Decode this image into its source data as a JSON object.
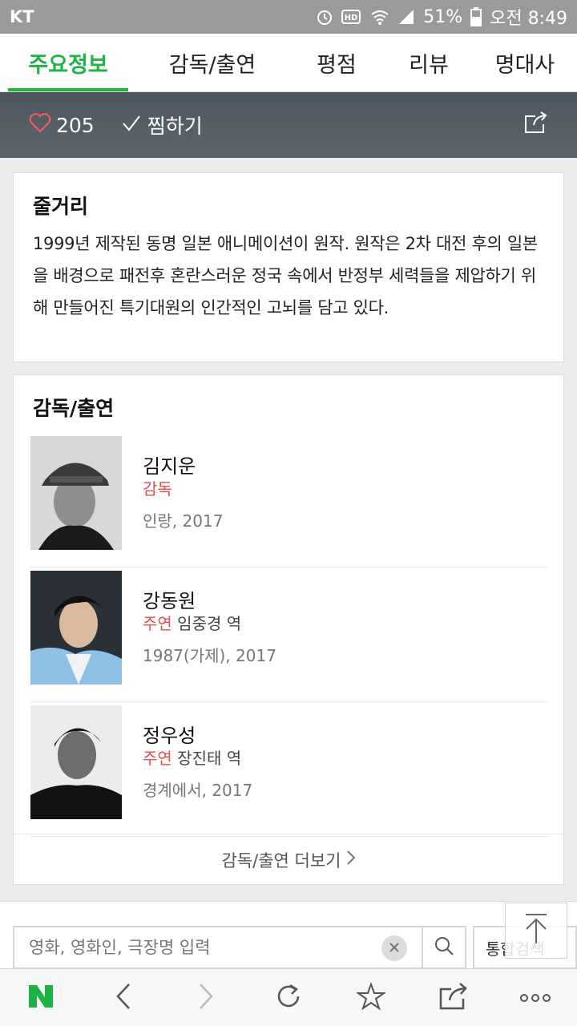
{
  "status_bar": {
    "carrier": "KT",
    "battery": "51%",
    "time": "오전 8:49",
    "hd_label": "HD"
  },
  "tabs": [
    {
      "label": "주요정보",
      "active": true
    },
    {
      "label": "감독/출연",
      "active": false
    },
    {
      "label": "평점",
      "active": false
    },
    {
      "label": "리뷰",
      "active": false
    },
    {
      "label": "명대사",
      "active": false
    }
  ],
  "action_bar": {
    "like_count": "205",
    "jjim_label": "찜하기"
  },
  "synopsis": {
    "title": "줄거리",
    "text": "1999년 제작된 동명 일본 애니메이션이 원작. 원작은 2차 대전 후의 일본을 배경으로 패전후 혼란스러운 정국 속에서 반정부 세력들을 제압하기 위해 만들어진 특기대원의 인간적인 고뇌를 담고 있다."
  },
  "cast": {
    "title": "감독/출연",
    "people": [
      {
        "name": "김지운",
        "role": "감독",
        "character": "",
        "works": "인랑, 2017"
      },
      {
        "name": "강동원",
        "role": "주연",
        "character": "임중경 역",
        "works": "1987(가제), 2017"
      },
      {
        "name": "정우성",
        "role": "주연",
        "character": "장진태 역",
        "works": "경계에서, 2017"
      }
    ],
    "more_label": "감독/출연 더보기"
  },
  "search": {
    "placeholder": "영화, 영화인, 극장명 입력",
    "total_label": "통합검색"
  },
  "colors": {
    "accent_green": "#1eb443",
    "role_red": "#e84c4c",
    "actionbar": "#555e66"
  }
}
